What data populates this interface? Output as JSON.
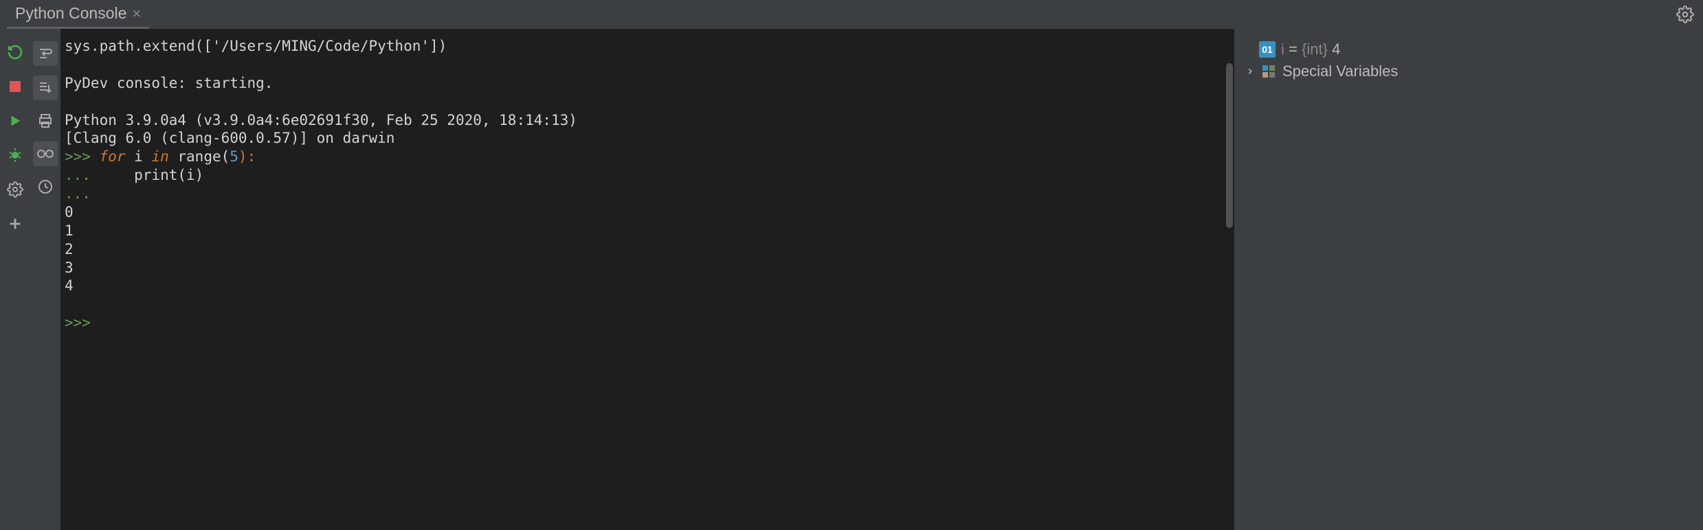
{
  "tab": {
    "title": "Python Console"
  },
  "console": {
    "lines": [
      {
        "type": "plain",
        "text": "sys.path.extend(['/Users/MING/Code/Python'])"
      },
      {
        "type": "blank",
        "text": ""
      },
      {
        "type": "plain",
        "text": "PyDev console: starting."
      },
      {
        "type": "blank",
        "text": ""
      },
      {
        "type": "plain",
        "text": "Python 3.9.0a4 (v3.9.0a4:6e02691f30, Feb 25 2020, 18:14:13) "
      },
      {
        "type": "plain",
        "text": "[Clang 6.0 (clang-600.0.57)] on darwin"
      },
      {
        "type": "for_line",
        "prompt": ">>> ",
        "kw1": "for",
        "mid1": " i ",
        "kw2": "in",
        "mid2": " range(",
        "num": "5",
        "tail": "):"
      },
      {
        "type": "prompt_plain",
        "prompt": "... ",
        "text": "    print(i)"
      },
      {
        "type": "prompt_only",
        "prompt": "... "
      },
      {
        "type": "plain",
        "text": "0"
      },
      {
        "type": "plain",
        "text": "1"
      },
      {
        "type": "plain",
        "text": "2"
      },
      {
        "type": "plain",
        "text": "3"
      },
      {
        "type": "plain",
        "text": "4"
      },
      {
        "type": "blank",
        "text": ""
      },
      {
        "type": "prompt_only",
        "prompt": ">>> "
      }
    ]
  },
  "variables": {
    "var_badge": "01",
    "var_name": "i",
    "var_eq": "=",
    "var_type": "{int}",
    "var_value": "4",
    "special_label": "Special Variables"
  }
}
